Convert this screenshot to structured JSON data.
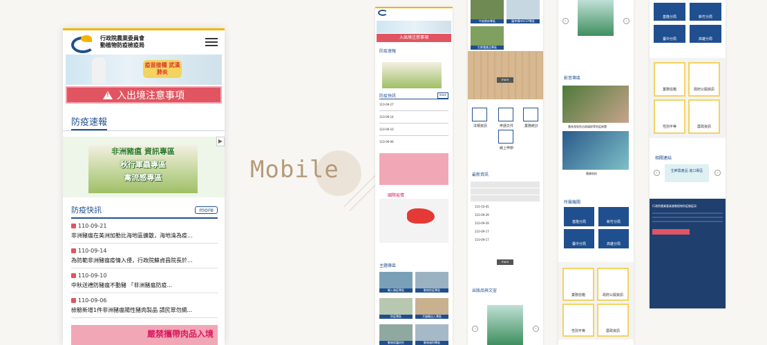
{
  "phone": {
    "org_line1": "行政院農業委員會",
    "org_line2": "動植物防疫檢疫局",
    "banner_text": "疫苗接種 武漢肺炎",
    "alert_text": "入出境注意事項",
    "section_title": "防疫速報",
    "promo_lines": [
      "非洲豬瘟 資訊專區",
      "秋行軍蟲專區",
      "禽流感專區"
    ],
    "news_title": "防疫快訊",
    "more_label": "more",
    "news": [
      {
        "date": "110-09-21",
        "text": "非洲豬瘟在美洲加勒比海地區擴散，海地淪為疫..."
      },
      {
        "date": "110-09-14",
        "text": "為防範非洲豬瘟疫情入侵，行政院蘇貞昌院長於..."
      },
      {
        "date": "110-09-10",
        "text": "中秋送禮防豬瘟不動豬 「非洲豬瘟防疫..."
      },
      {
        "date": "110-09-06",
        "text": "檢驗新增1件非洲豬瘟陽性豬肉製品 請民眾勿網..."
      }
    ],
    "pink_banner_text": "嚴禁攜帶肉品入境"
  },
  "center_label": "Mobile",
  "s1": {
    "alert": "入出境注意事項",
    "sec1": "防疫速報",
    "sec2": "防疫快訊",
    "more": "more",
    "sec3": "國際疫情",
    "sec4": "主題專區",
    "dates": [
      "110-09-27",
      "110-09-14",
      "110-09-10",
      "110-09-06"
    ],
    "topics": [
      "輸入檢疫專區",
      "動物防疫專區",
      "防疫專區",
      "犬貓輸出入專區",
      "動物保護研究",
      "動物福利專區"
    ]
  },
  "s2": {
    "top_labels": [
      "牛結節疹專區",
      "屠宰場HACCP專區",
      "生鮮農產品專區"
    ],
    "more": "more",
    "icons": [
      "法規資訊",
      "申請文件",
      "業務統計",
      "線上申辦"
    ],
    "sec_latest": "最新資訊",
    "latest_dates": [
      "110-10-05",
      "110-09-29",
      "110-09-29",
      "110-09-17",
      "110-09-17"
    ],
    "sec_pub": "出版品與文宣"
  },
  "s3": {
    "sec_video": "影音專區",
    "video_caption": "農林漁牧防治病媒蚊等防疫新聞",
    "video_caption2": "農業航拍",
    "sec_units": "所屬機關",
    "units": [
      "基隆分局",
      "新竹分局",
      "臺中分局",
      "高雄分局"
    ],
    "services": [
      "業務信箱",
      "政府公開資訊",
      "性別平等",
      "農政資訊"
    ]
  },
  "s4": {
    "units": [
      "基隆分局",
      "新竹分局",
      "臺中分局",
      "高雄分局"
    ],
    "services": [
      "業務信箱",
      "政府公開資訊",
      "性別平等",
      "農政資訊"
    ],
    "sec_links": "相關連結",
    "link_banner": "生鮮農產品 進口專區",
    "footer_title": "行政院農業委員會動植物防疫檢疫局"
  }
}
